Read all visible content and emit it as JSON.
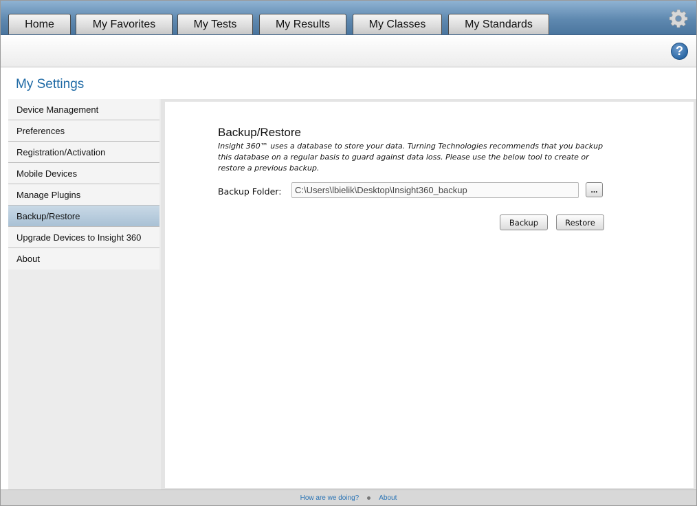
{
  "nav": {
    "tabs": [
      {
        "label": "Home"
      },
      {
        "label": "My Favorites"
      },
      {
        "label": "My Tests"
      },
      {
        "label": "My Results"
      },
      {
        "label": "My Classes"
      },
      {
        "label": "My Standards"
      }
    ],
    "settings_icon": "gear-icon",
    "help_icon": "help-icon",
    "help_glyph": "?"
  },
  "page": {
    "title": "My Settings"
  },
  "sidebar": {
    "items": [
      {
        "label": "Device Management"
      },
      {
        "label": "Preferences"
      },
      {
        "label": "Registration/Activation"
      },
      {
        "label": "Mobile Devices"
      },
      {
        "label": "Manage Plugins"
      },
      {
        "label": "Backup/Restore",
        "selected": true
      },
      {
        "label": "Upgrade Devices to Insight 360"
      },
      {
        "label": "About"
      }
    ]
  },
  "backup": {
    "title": "Backup/Restore",
    "description": "Insight 360™ uses a database to store your data. Turning Technologies recommends that you backup this database on a regular basis to guard against data loss. Please use the below tool to create or restore a previous backup.",
    "folder_label": "Backup Folder:",
    "folder_value": "C:\\Users\\lbielik\\Desktop\\Insight360_backup",
    "browse_label": "...",
    "backup_button": "Backup",
    "restore_button": "Restore"
  },
  "footer": {
    "feedback_link": "How are we doing?",
    "about_link": "About"
  },
  "colors": {
    "accent": "#1f6aa5",
    "topbar": "#5f89b0",
    "selected_item": "#b5cadb"
  }
}
